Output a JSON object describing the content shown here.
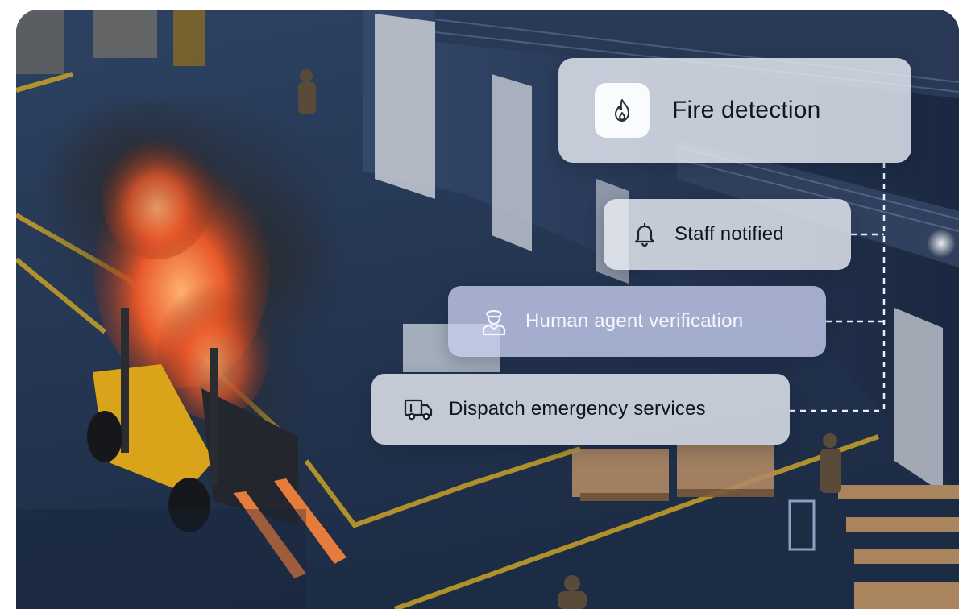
{
  "steps": {
    "fire_detection": {
      "label": "Fire detection",
      "icon": "flame-icon"
    },
    "staff_notified": {
      "label": "Staff notified",
      "icon": "bell-icon"
    },
    "human_verification": {
      "label": "Human agent verification",
      "icon": "security-agent-icon"
    },
    "dispatch": {
      "label": "Dispatch emergency services",
      "icon": "truck-icon"
    }
  },
  "colors": {
    "floor": "#2a3b58",
    "floor_line": "#c9a227",
    "fire": "#e2552a",
    "smoke": "#2b2d33",
    "forklift": "#d9a419",
    "card": "#eef1f8",
    "card_accent": "#c4cced"
  }
}
